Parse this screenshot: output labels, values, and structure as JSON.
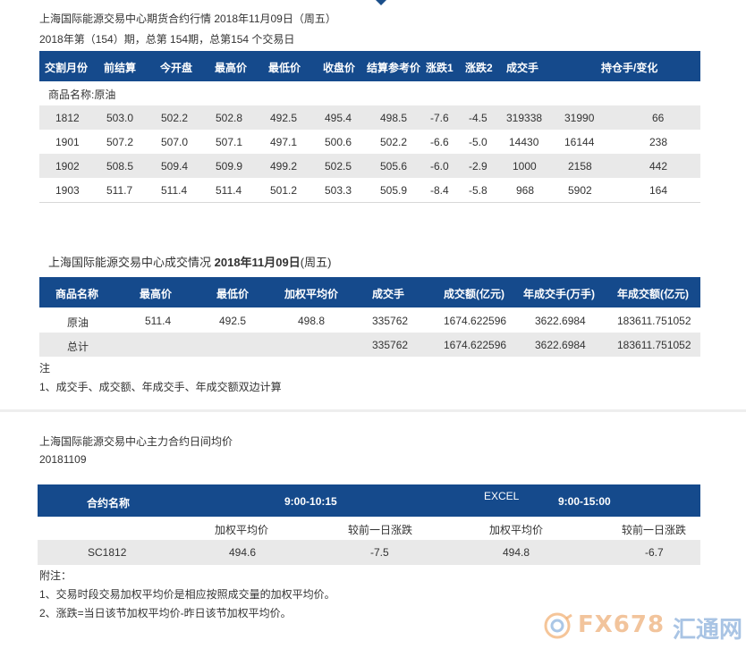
{
  "section1": {
    "title": "上海国际能源交易中心期货合约行情 2018年11月09日（周五）",
    "subtitle": "2018年第（154）期，总第 154期，总第154 个交易日",
    "headers": [
      "交割月份",
      "前结算",
      "今开盘",
      "最高价",
      "最低价",
      "收盘价",
      "结算参考价",
      "涨跌1",
      "涨跌2",
      "成交手",
      "持仓手/变化"
    ],
    "product_label": "商品名称:原油",
    "rows": [
      [
        "1812",
        "503.0",
        "502.2",
        "502.8",
        "492.5",
        "495.4",
        "498.5",
        "-7.6",
        "-4.5",
        "319338",
        "31990",
        "66"
      ],
      [
        "1901",
        "507.2",
        "507.0",
        "507.1",
        "497.1",
        "500.6",
        "502.2",
        "-6.6",
        "-5.0",
        "14430",
        "16144",
        "238"
      ],
      [
        "1902",
        "508.5",
        "509.4",
        "509.9",
        "499.2",
        "502.5",
        "505.6",
        "-6.0",
        "-2.9",
        "1000",
        "2158",
        "442"
      ],
      [
        "1903",
        "511.7",
        "511.4",
        "511.4",
        "501.2",
        "503.3",
        "505.9",
        "-8.4",
        "-5.8",
        "968",
        "5902",
        "164"
      ]
    ]
  },
  "section2": {
    "title_prefix": "上海国际能源交易中心成交情况 ",
    "title_bold": "2018年11月09日",
    "title_suffix": "(周五)",
    "headers": [
      "商品名称",
      "最高价",
      "最低价",
      "加权平均价",
      "成交手",
      "成交额(亿元)",
      "年成交手(万手)",
      "年成交额(亿元)"
    ],
    "rows": [
      [
        "原油",
        "511.4",
        "492.5",
        "498.8",
        "335762",
        "1674.622596",
        "3622.6984",
        "183611.751052"
      ],
      [
        "总计",
        "",
        "",
        "",
        "335762",
        "1674.622596",
        "3622.6984",
        "183611.751052"
      ]
    ],
    "note_label": "注",
    "note_text": "1、成交手、成交额、年成交手、年成交额双边计算"
  },
  "section3": {
    "title": "上海国际能源交易中心主力合约日间均价",
    "date": "20181109",
    "headers": {
      "contract": "合约名称",
      "session1": "9:00-10:15",
      "excel": "EXCEL",
      "session2": "9:00-15:00"
    },
    "subheaders": [
      "加权平均价",
      "较前一日涨跌",
      "加权平均价",
      "较前一日涨跌"
    ],
    "row": [
      "SC1812",
      "494.6",
      "-7.5",
      "494.8",
      "-6.7"
    ],
    "notes_label": "附注：",
    "notes": [
      "1、交易时段交易加权平均价是相应按照成交量的加权平均价。",
      "2、涨跌=当日该节加权平均价-昨日该节加权平均价。"
    ]
  },
  "watermark": {
    "brand": "FX678",
    "cn": "汇通网"
  }
}
